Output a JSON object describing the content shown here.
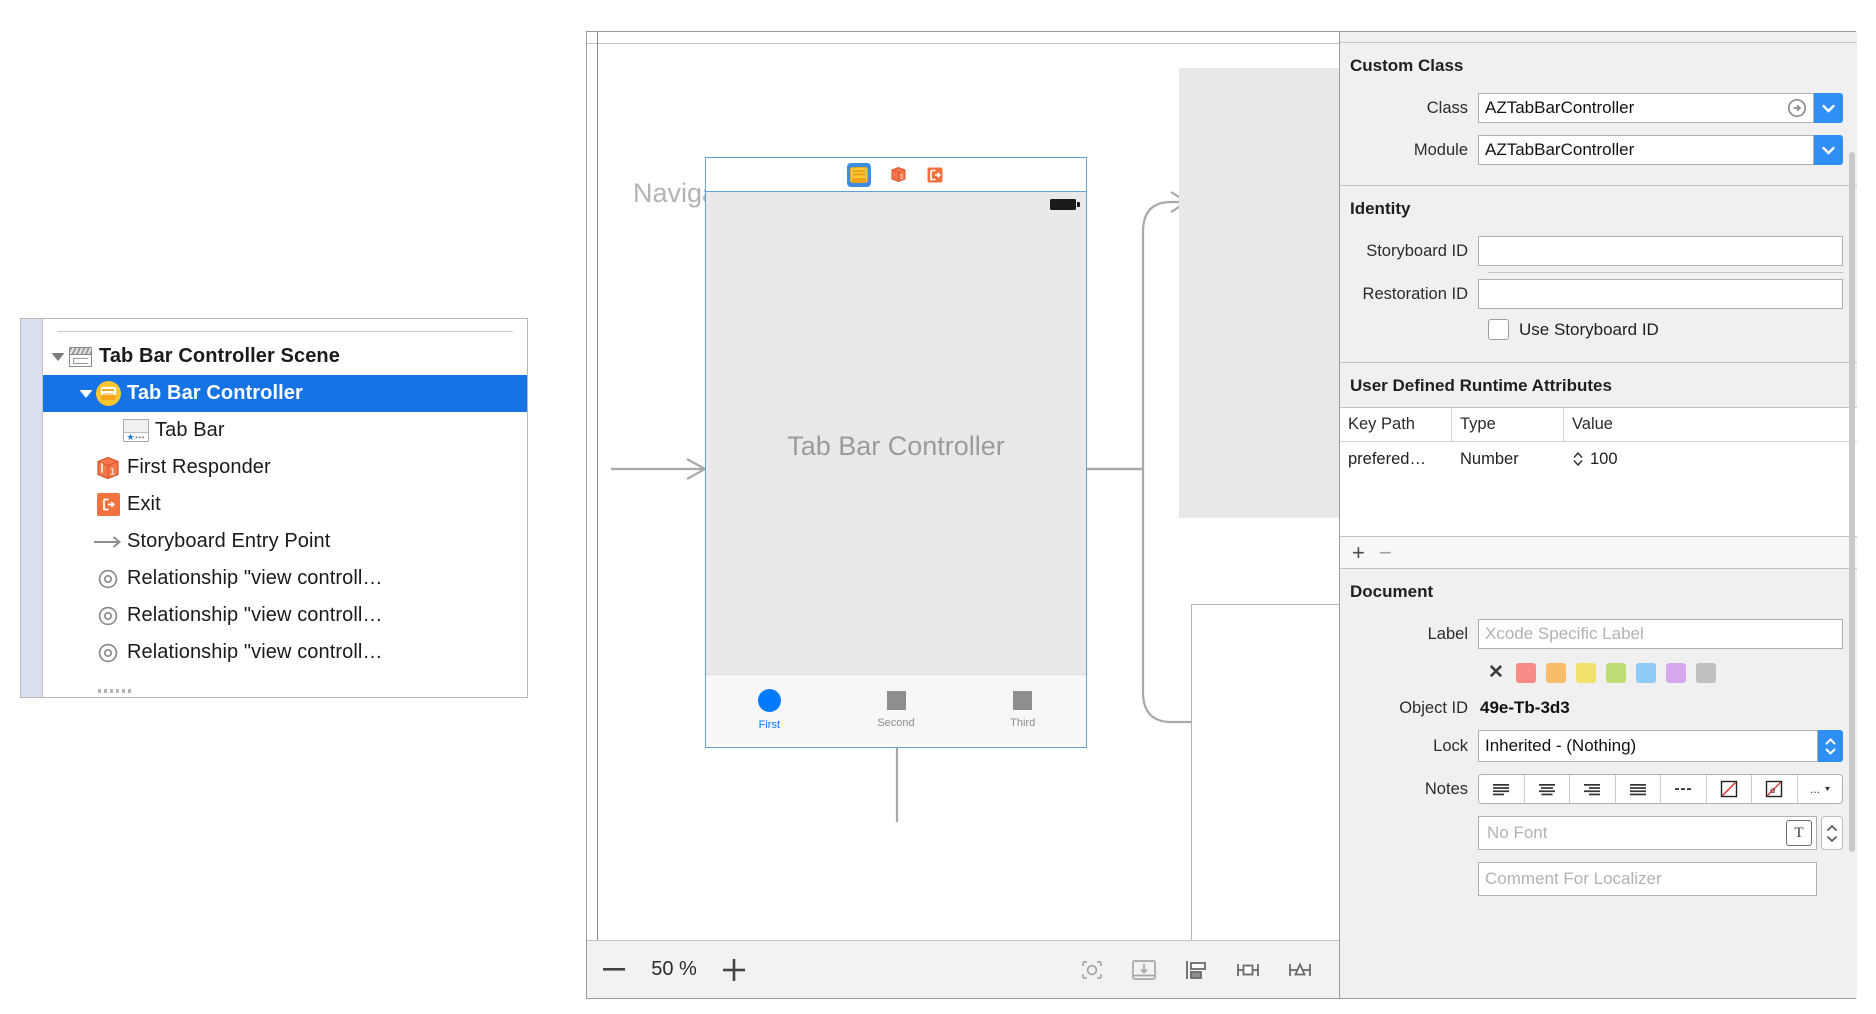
{
  "outline": {
    "items": [
      {
        "label": "Tab Bar Controller Scene",
        "icon": "storyboard-scene-icon",
        "depth": 0,
        "disclosure": "down",
        "bold": true,
        "selected": false
      },
      {
        "label": "Tab Bar Controller",
        "icon": "tab-bar-controller-icon",
        "depth": 1,
        "disclosure": "down",
        "bold": true,
        "selected": true
      },
      {
        "label": "Tab Bar",
        "icon": "tab-bar-icon",
        "depth": 2,
        "disclosure": "none",
        "bold": false,
        "selected": false
      },
      {
        "label": "First Responder",
        "icon": "first-responder-cube-icon",
        "depth": 1,
        "disclosure": "none",
        "bold": false,
        "selected": false
      },
      {
        "label": "Exit",
        "icon": "exit-icon",
        "depth": 1,
        "disclosure": "none",
        "bold": false,
        "selected": false
      },
      {
        "label": "Storyboard Entry Point",
        "icon": "entry-point-arrow-icon",
        "depth": 1,
        "disclosure": "none",
        "bold": false,
        "selected": false
      },
      {
        "label": "Relationship \"view controll…",
        "icon": "relationship-icon",
        "depth": 1,
        "disclosure": "none",
        "bold": false,
        "selected": false
      },
      {
        "label": "Relationship \"view controll…",
        "icon": "relationship-icon",
        "depth": 1,
        "disclosure": "none",
        "bold": false,
        "selected": false
      },
      {
        "label": "Relationship \"view controll…",
        "icon": "relationship-icon",
        "depth": 1,
        "disclosure": "none",
        "bold": false,
        "selected": false
      }
    ]
  },
  "canvas": {
    "device": {
      "title": "Tab Bar Controller",
      "tabs": [
        {
          "label": "First",
          "glyph": "circle",
          "active": true
        },
        {
          "label": "Second",
          "glyph": "square",
          "active": false
        },
        {
          "label": "Third",
          "glyph": "square",
          "active": false
        }
      ]
    },
    "ghost_scene_label": "Navigati"
  },
  "toolbar": {
    "zoom_out": "−",
    "zoom_level": "50 %",
    "zoom_in": "+",
    "buttons": [
      "update-frames-icon",
      "embed-in-icon",
      "align-icon",
      "pin-icon",
      "resolve-issues-icon"
    ]
  },
  "inspector": {
    "custom_class": {
      "title": "Custom Class",
      "class_label": "Class",
      "class_value": "AZTabBarController",
      "module_label": "Module",
      "module_value": "AZTabBarController"
    },
    "identity": {
      "title": "Identity",
      "storyboard_id_label": "Storyboard ID",
      "storyboard_id_value": "",
      "restoration_id_label": "Restoration ID",
      "restoration_id_value": "",
      "use_storyboard_id_label": "Use Storyboard ID",
      "use_storyboard_id_checked": false
    },
    "runtime_attributes": {
      "title": "User Defined Runtime Attributes",
      "columns": [
        "Key Path",
        "Type",
        "Value"
      ],
      "rows": [
        {
          "key_path": "prefered…",
          "type": "Number",
          "value": "100"
        }
      ],
      "add_label": "+",
      "remove_label": "−"
    },
    "document": {
      "title": "Document",
      "label_label": "Label",
      "label_placeholder": "Xcode Specific Label",
      "label_value": "",
      "swatch_clear": "✕",
      "swatches": [
        "#f98b86",
        "#f6bd6a",
        "#f3e16e",
        "#bfdd72",
        "#8fcbf5",
        "#d8a8ec",
        "#c0c0c0"
      ],
      "object_id_label": "Object ID",
      "object_id_value": "49e-Tb-3d3",
      "lock_label": "Lock",
      "lock_value": "Inherited - (Nothing)",
      "notes_label": "Notes",
      "notes_buttons": [
        "align-left-icon",
        "align-center-icon",
        "align-right-icon",
        "align-justify-icon",
        "list-dash-icon",
        "no-color-icon",
        "strikethrough-a-icon",
        "more-options-icon"
      ],
      "font_placeholder": "No Font",
      "font_value": "",
      "comment_placeholder": "Comment For Localizer",
      "comment_value": ""
    }
  }
}
